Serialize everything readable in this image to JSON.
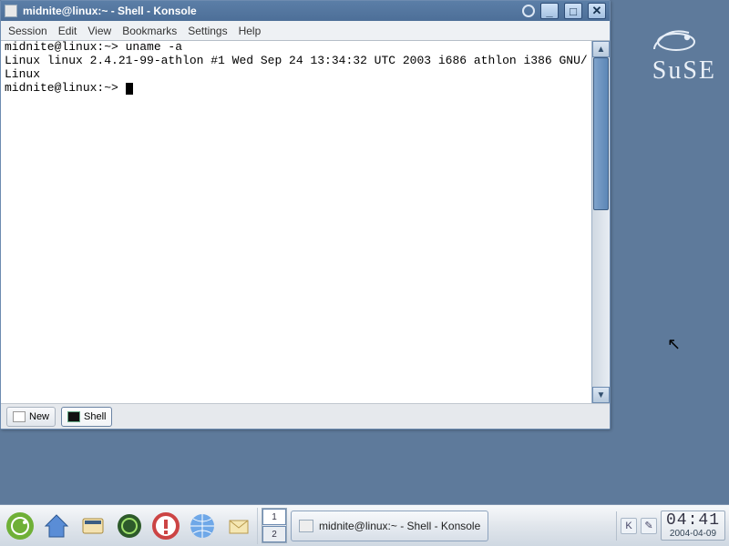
{
  "desktop": {
    "logo_text": "SuSE"
  },
  "window": {
    "title": "midnite@linux:~ - Shell - Konsole",
    "menu": [
      "Session",
      "Edit",
      "View",
      "Bookmarks",
      "Settings",
      "Help"
    ],
    "terminal": {
      "prompt": "midnite@linux:~> ",
      "command": "uname -a",
      "output_line": "Linux linux 2.4.21-99-athlon #1 Wed Sep 24 13:34:32 UTC 2003 i686 athlon i386 GNU/Linux",
      "prompt2": "midnite@linux:~> "
    },
    "tabs": {
      "new_label": "New",
      "shell_label": "Shell"
    }
  },
  "taskbar": {
    "pager": {
      "workspaces": [
        "1",
        "2"
      ],
      "active": 0
    },
    "task_label": "midnite@linux:~ - Shell - Konsole",
    "tray_labels": [
      "K",
      "✎"
    ],
    "clock": {
      "time": "04:41",
      "date": "2004-04-09"
    }
  }
}
